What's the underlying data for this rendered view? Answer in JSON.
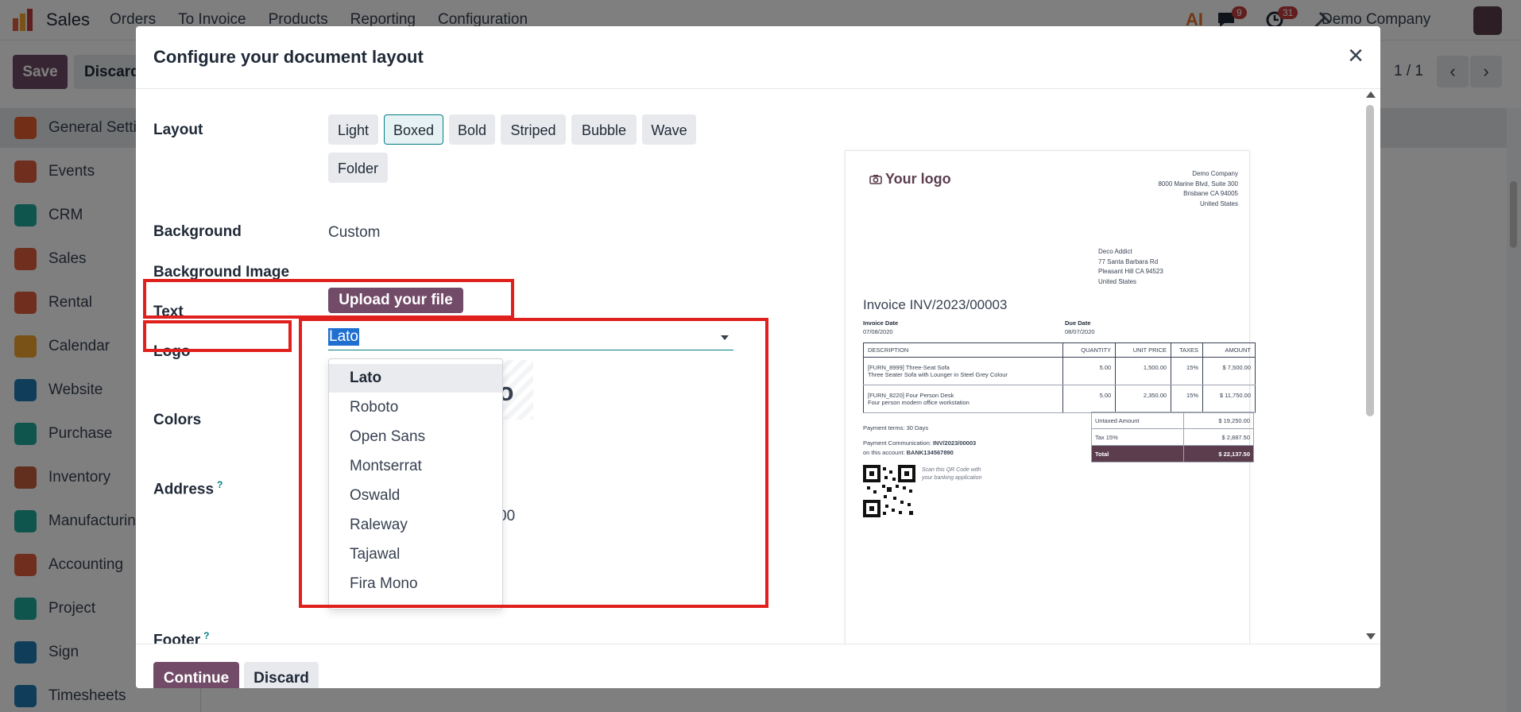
{
  "app": {
    "name": "Sales",
    "menu": [
      "Orders",
      "To Invoice",
      "Products",
      "Reporting",
      "Configuration"
    ],
    "ai_label": "AI",
    "messages_badge": "9",
    "activities_badge": "31",
    "company": "Demo Company"
  },
  "controls": {
    "save": "Save",
    "discard": "Discard",
    "pager": "1 / 1",
    "prev": "‹",
    "next": "›"
  },
  "sidebar": {
    "items": [
      {
        "label": "General Settings",
        "color": "#e65c2e"
      },
      {
        "label": "Events",
        "color": "#e05d3c"
      },
      {
        "label": "CRM",
        "color": "#20a89c"
      },
      {
        "label": "Sales",
        "color": "#e05d3c"
      },
      {
        "label": "Rental",
        "color": "#e05d3c"
      },
      {
        "label": "Calendar",
        "color": "#f0a42e"
      },
      {
        "label": "Website",
        "color": "#1f7bb5"
      },
      {
        "label": "Purchase",
        "color": "#20a89c"
      },
      {
        "label": "Inventory",
        "color": "#c55e3f"
      },
      {
        "label": "Manufacturing",
        "color": "#20a89c"
      },
      {
        "label": "Accounting",
        "color": "#e05d3c"
      },
      {
        "label": "Project",
        "color": "#20a89c"
      },
      {
        "label": "Sign",
        "color": "#1f7bb5"
      },
      {
        "label": "Timesheets",
        "color": "#1f7bb5"
      }
    ]
  },
  "modal": {
    "title": "Configure your document layout",
    "close_icon": "×",
    "labels": {
      "layout": "Layout",
      "background": "Background",
      "background_image": "Background Image",
      "text": "Text",
      "logo": "Logo",
      "colors": "Colors",
      "address": "Address",
      "address_help": "?",
      "footer_cut": "Footer",
      "footer_help": "?"
    },
    "layout_options": [
      "Light",
      "Boxed",
      "Bold",
      "Striped",
      "Bubble",
      "Wave",
      "Folder"
    ],
    "layout_selected": "Boxed",
    "background_value": "Custom",
    "upload_label": "Upload your file",
    "font_value": "Lato",
    "font_options": [
      "Lato",
      "Roboto",
      "Open Sans",
      "Montserrat",
      "Oswald",
      "Raleway",
      "Tajawal",
      "Fira Mono"
    ],
    "hidden_logo_fragment": "o",
    "hidden_address_fragment": "00",
    "continue": "Continue",
    "discard": "Discard"
  },
  "preview": {
    "logo": "Your logo",
    "company_lines": [
      "Demo Company",
      "8000 Marine Blvd, Suite 300",
      "Brisbane CA 94005",
      "United States"
    ],
    "customer_lines": [
      "Deco Addict",
      "77 Santa Barbara Rd",
      "Pleasant Hill CA 94523",
      "United States"
    ],
    "invoice_title": "Invoice INV/2023/00003",
    "invoice_date_label": "Invoice Date",
    "invoice_date": "07/08/2020",
    "due_date_label": "Due Date",
    "due_date": "08/07/2020",
    "columns": [
      "DESCRIPTION",
      "QUANTITY",
      "UNIT PRICE",
      "TAXES",
      "AMOUNT"
    ],
    "rows": [
      {
        "desc1": "[FURN_8999] Three-Seat Sofa",
        "desc2": "Three Seater Sofa with Lounger in Steel Grey Colour",
        "qty": "5.00",
        "price": "1,500.00",
        "tax": "15%",
        "amount": "$ 7,500.00"
      },
      {
        "desc1": "[FURN_8220] Four Person Desk",
        "desc2": "Four person modern office workstation",
        "qty": "5.00",
        "price": "2,350.00",
        "tax": "15%",
        "amount": "$ 11,750.00"
      }
    ],
    "payment_terms": "Payment terms: 30 Days",
    "payment_comm_label": "Payment Communication:",
    "payment_comm": "INV/2023/00003",
    "account_label": "on this account:",
    "account": "BANK134567890",
    "qr_text_1": "Scan this QR Code with",
    "qr_text_2": "your banking application",
    "totals": [
      {
        "label": "Untaxed Amount",
        "value": "$ 19,250.00"
      },
      {
        "label": "Tax 15%",
        "value": "$ 2,887.50"
      },
      {
        "label": "Total",
        "value": "$ 22,137.50"
      }
    ]
  }
}
